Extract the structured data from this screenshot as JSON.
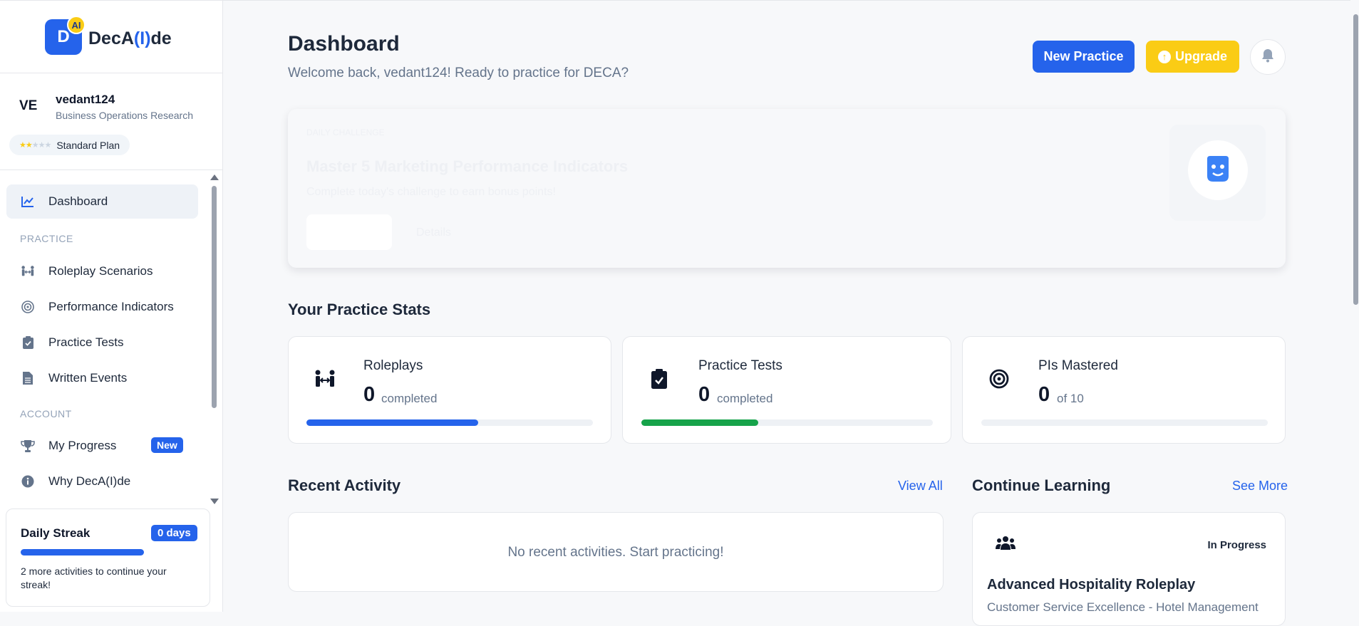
{
  "brand": {
    "logo_letter": "D",
    "logo_badge": "AI",
    "name_prefix": "DecA",
    "name_accent": "(I)",
    "name_suffix": "de"
  },
  "user": {
    "initials": "VE",
    "name": "vedant124",
    "event": "Business Operations Research",
    "plan": "Standard Plan",
    "plan_stars": 2,
    "plan_stars_total": 5
  },
  "nav": {
    "dashboard": "Dashboard",
    "section_practice": "PRACTICE",
    "roleplay": "Roleplay Scenarios",
    "pi": "Performance Indicators",
    "tests": "Practice Tests",
    "written": "Written Events",
    "section_account": "ACCOUNT",
    "progress": "My Progress",
    "progress_badge": "New",
    "why": "Why DecA(I)de"
  },
  "streak": {
    "title": "Daily Streak",
    "badge": "0 days",
    "message": "2 more activities to continue your streak!"
  },
  "header": {
    "title": "Dashboard",
    "subtitle": "Welcome back, vedant124! Ready to practice for DECA?",
    "new_practice": "New Practice",
    "upgrade": "Upgrade"
  },
  "challenge": {
    "tag": "DAILY CHALLENGE",
    "title": "Master 5 Marketing Performance Indicators",
    "subtitle": "Complete today's challenge to earn bonus points!",
    "details": "Details"
  },
  "stats": {
    "title": "Your Practice Stats",
    "roleplays": {
      "label": "Roleplays",
      "value": "0",
      "unit": "completed",
      "progress": 0.6
    },
    "tests": {
      "label": "Practice Tests",
      "value": "0",
      "unit": "completed",
      "progress": 0.4
    },
    "pis": {
      "label": "PIs Mastered",
      "value": "0",
      "unit": "of 10",
      "progress": 0
    }
  },
  "activity": {
    "title": "Recent Activity",
    "view_all": "View All",
    "empty": "No recent activities. Start practicing!"
  },
  "learning": {
    "title": "Continue Learning",
    "see_more": "See More",
    "status": "In Progress",
    "card_title": "Advanced Hospitality Roleplay",
    "card_sub": "Customer Service Excellence - Hotel Management"
  },
  "colors": {
    "primary": "#2563eb",
    "upgrade": "#facc15",
    "success": "#16a34a"
  }
}
